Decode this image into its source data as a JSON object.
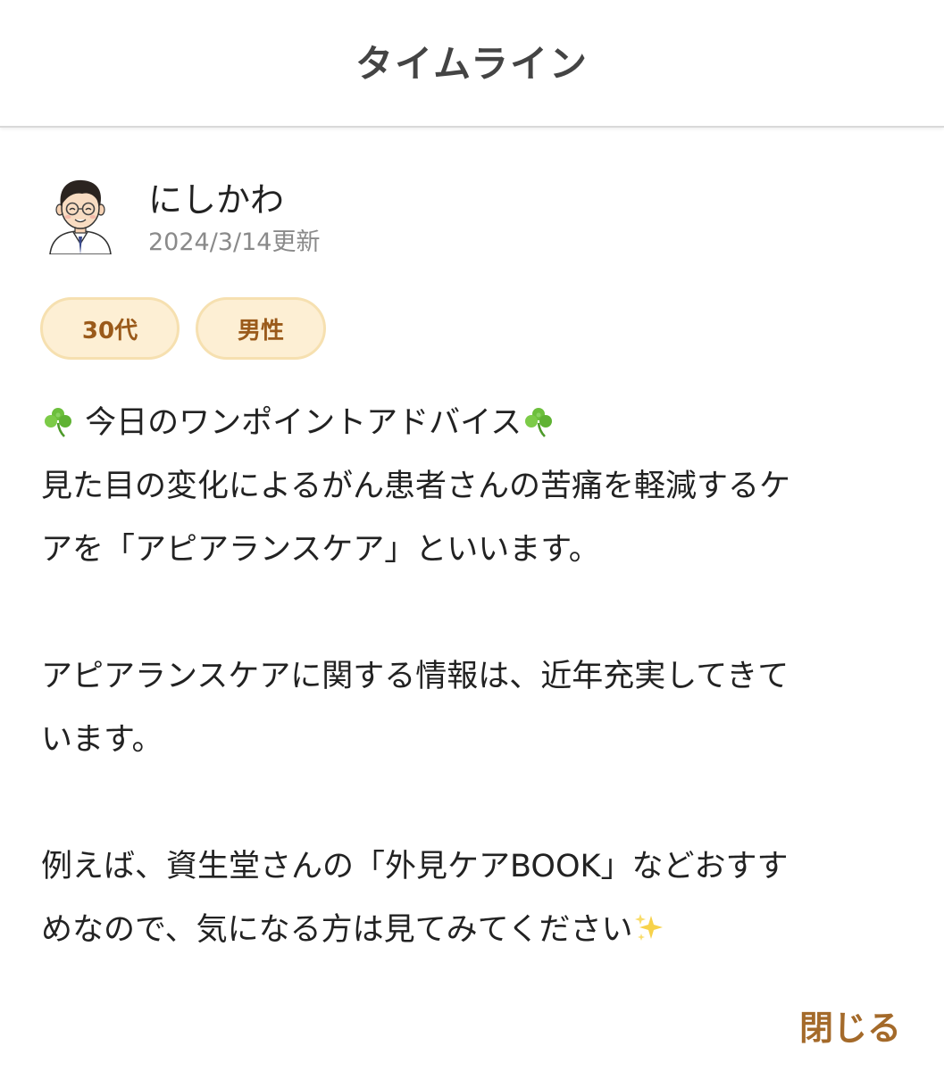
{
  "header": {
    "title": "タイムライン"
  },
  "post": {
    "author": "にしかわ",
    "date": "2024/3/14更新",
    "tags": [
      "30代",
      "男性"
    ],
    "body": {
      "line1": "今日のワンポイントアドバイス",
      "line2": "見た目の変化によるがん患者さんの苦痛を軽減するケ",
      "line3": "アを「アピアランスケア」といいます。",
      "line4": "アピアランスケアに関する情報は、近年充実してきて",
      "line5": "います。",
      "line6": "例えば、資生堂さんの「外見ケアBOOK」などおすす",
      "line7": "めなので、気になる方は見てみてください"
    },
    "icons": {
      "clover": "clover-icon",
      "sparkles": "sparkles-icon",
      "avatar": "doctor-avatar"
    }
  },
  "footer": {
    "close_label": "閉じる"
  }
}
